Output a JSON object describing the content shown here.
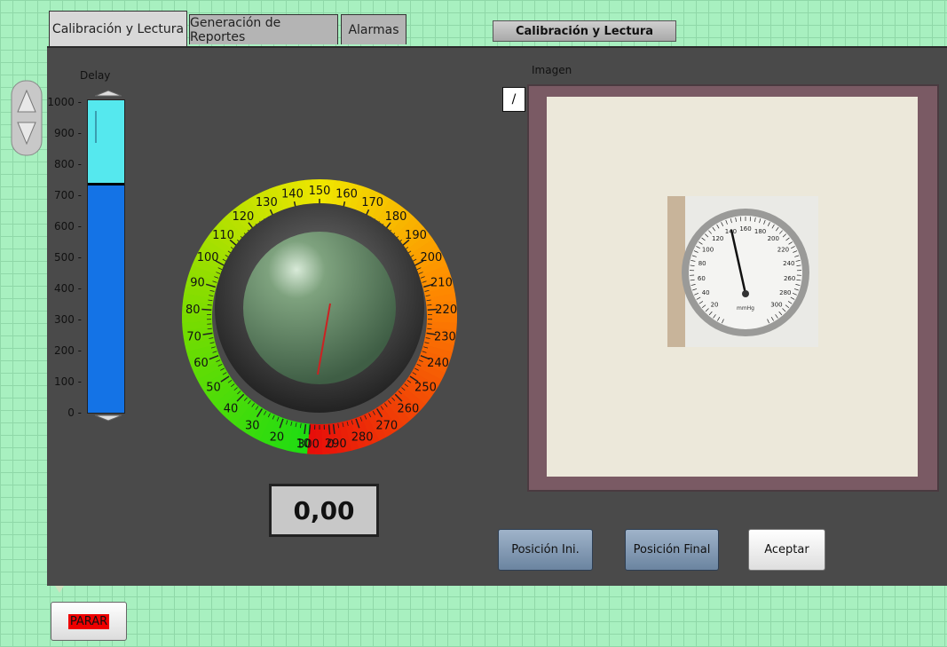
{
  "tabs": [
    {
      "label": "Calibración y Lectura",
      "active": true
    },
    {
      "label": "Generación de Reportes",
      "active": false
    },
    {
      "label": "Alarmas",
      "active": false
    }
  ],
  "section_label": "Calibración y Lectura",
  "delay": {
    "label": "Delay",
    "ticks": [
      "1000",
      "900",
      "800",
      "700",
      "600",
      "500",
      "400",
      "300",
      "200",
      "100",
      "0"
    ],
    "value": 735,
    "max": 1000
  },
  "gauge": {
    "labels": [
      "0",
      "10",
      "20",
      "30",
      "40",
      "50",
      "60",
      "70",
      "80",
      "90",
      "100",
      "110",
      "120",
      "130",
      "140",
      "150",
      "160",
      "170",
      "180",
      "190",
      "200",
      "210",
      "220",
      "230",
      "240",
      "250",
      "260",
      "270",
      "280",
      "290",
      "300"
    ],
    "min": 0,
    "max": 300,
    "needle_value": 150,
    "readout": "0,00"
  },
  "image": {
    "label": "Imagen",
    "tool_glyph": "/",
    "photo_dial_labels": [
      "20",
      "40",
      "60",
      "80",
      "100",
      "120",
      "140",
      "160",
      "180",
      "200",
      "220",
      "240",
      "260",
      "280",
      "300"
    ],
    "photo_text": "mmHg"
  },
  "buttons": {
    "pos_ini": "Posición Ini.",
    "pos_final": "Posición Final",
    "aceptar": "Aceptar",
    "parar": "PARAR"
  },
  "colors": {
    "panel": "#4a4a4a",
    "slider_fill": "#1473e6",
    "slider_empty": "#55e8ee",
    "needle": "#cc2222"
  }
}
